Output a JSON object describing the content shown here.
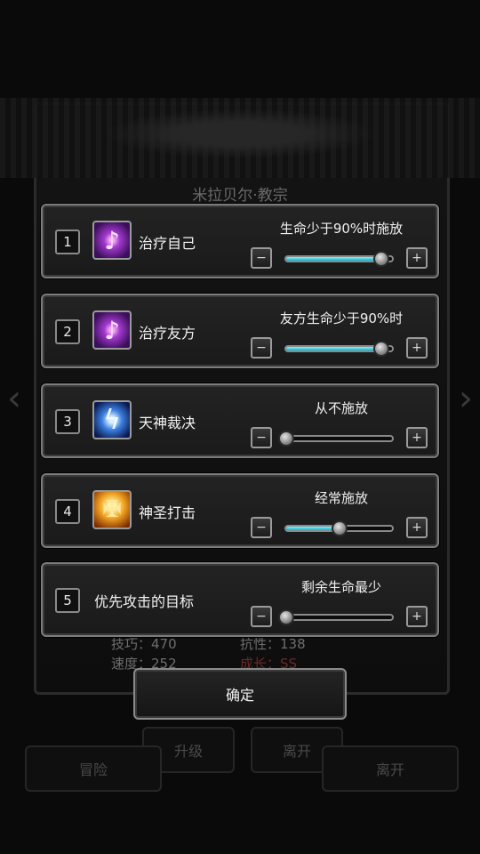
{
  "background": {
    "title": "米拉贝尔·教宗",
    "stats": [
      {
        "left": "技巧：470",
        "right": "抗性：138"
      },
      {
        "left": "速度：252",
        "right": "成长：SS"
      }
    ],
    "buttons": {
      "upgrade": "升级",
      "leave": "离开",
      "adventure": "冒险",
      "leave2": "离开"
    }
  },
  "skills": [
    {
      "index": "1",
      "name": "治疗自己",
      "condition": "生命少于90%时施放",
      "icon": "heal-icon",
      "level": 0.9
    },
    {
      "index": "2",
      "name": "治疗友方",
      "condition": "友方生命少于90%时",
      "icon": "heal-icon",
      "level": 0.9
    },
    {
      "index": "3",
      "name": "天神裁决",
      "condition": "从不施放",
      "icon": "lightning-icon",
      "level": 0.0
    },
    {
      "index": "4",
      "name": "神圣打击",
      "condition": "经常施放",
      "icon": "holy-strike-icon",
      "level": 0.5
    },
    {
      "index": "5",
      "name": "优先攻击的目标",
      "condition": "剩余生命最少",
      "icon": "",
      "level": 0.0
    }
  ],
  "confirm_label": "确定",
  "colors": {
    "slider_fill": "#1ab0c4",
    "panel_border": "#7c7c7c"
  }
}
